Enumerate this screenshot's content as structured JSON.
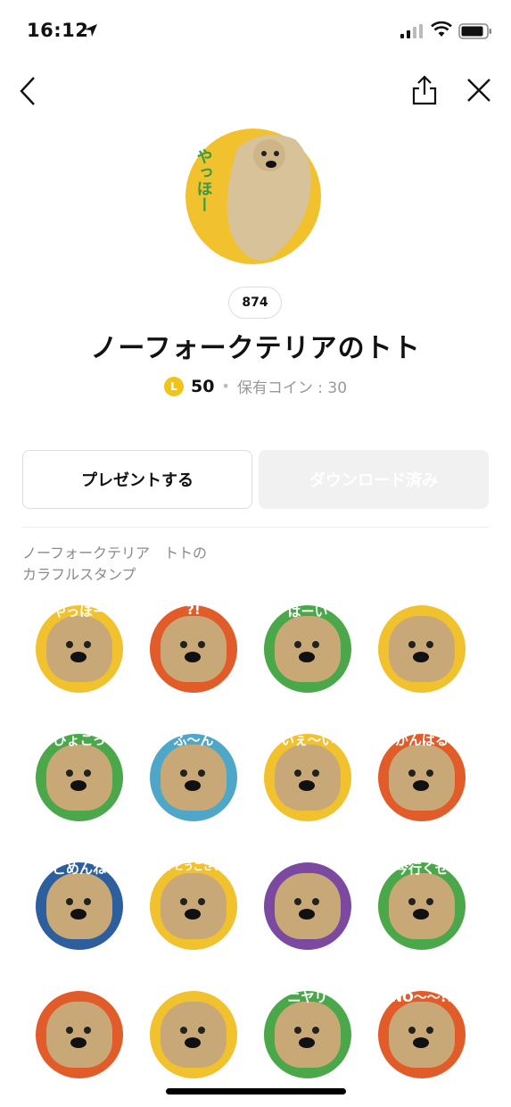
{
  "status_bar": {
    "time": "16:12"
  },
  "nav": {
    "back_icon": "chevron-left-icon",
    "share_icon": "share-icon",
    "close_icon": "close-icon"
  },
  "hero": {
    "caption": "やっほー"
  },
  "badge": {
    "count": "874"
  },
  "title": "ノーフォークテリアのトト",
  "price": {
    "coin_symbol": "L",
    "value": "50",
    "owned": "保有コイン : 30"
  },
  "buttons": {
    "gift": "プレゼントする",
    "download": "ダウンロード済み"
  },
  "description": "ノーフォークテリア　トトの\nカラフルスタンプ",
  "stickers": [
    {
      "caption": "やっほー",
      "color": "#f2c12e"
    },
    {
      "caption": "?!",
      "color": "#e25c2a"
    },
    {
      "caption": "はーい",
      "color": "#4aa84b"
    },
    {
      "caption": "",
      "color": "#f2c12e"
    },
    {
      "caption": "ひょこっ",
      "color": "#4aa84b"
    },
    {
      "caption": "ふ〜ん",
      "color": "#4ea7c9"
    },
    {
      "caption": "いぇ〜い",
      "color": "#f2c12e"
    },
    {
      "caption": "がんばる",
      "color": "#e25c2a"
    },
    {
      "caption": "ごめんね",
      "color": "#2d5e9e"
    },
    {
      "caption": "ありがとうございます",
      "color": "#f2c12e"
    },
    {
      "caption": "",
      "color": "#7b4aa0"
    },
    {
      "caption": "今行くぜ",
      "color": "#4aa84b"
    },
    {
      "caption": "",
      "color": "#e25c2a"
    },
    {
      "caption": "",
      "color": "#f2c12e"
    },
    {
      "caption": "ニヤリ",
      "color": "#4aa84b"
    },
    {
      "caption": "NO〜〜!!",
      "color": "#e25c2a"
    }
  ],
  "colors": {
    "accent_yellow": "#f2c12e",
    "coin": "#f2c418"
  }
}
